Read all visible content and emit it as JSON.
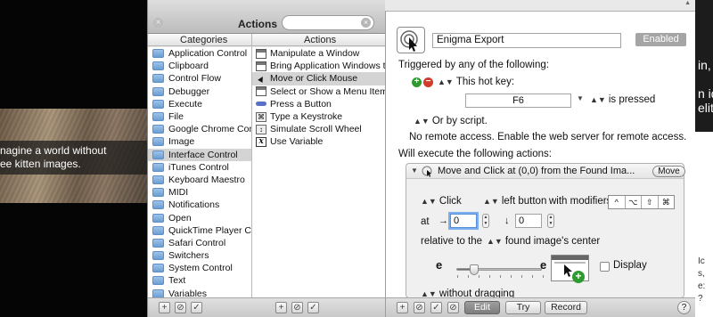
{
  "background": {
    "caption_lines": [
      "nagine a world without",
      "ee kitten images."
    ],
    "right_fragments": [
      "in,",
      "n id",
      "elit."
    ],
    "right_small": [
      "Ic",
      "s,",
      "e:",
      "?"
    ]
  },
  "window": {
    "title": "Actions",
    "close_glyph": "×",
    "clear_glyph": "×"
  },
  "columns": {
    "categories_header": "Categories",
    "actions_header": "Actions"
  },
  "categories": [
    "Application Control",
    "Clipboard",
    "Control Flow",
    "Debugger",
    "Execute",
    "File",
    "Google Chrome Control",
    "Image",
    "Interface Control",
    "iTunes Control",
    "Keyboard Maestro",
    "MIDI",
    "Notifications",
    "Open",
    "QuickTime Player Co...",
    "Safari Control",
    "Switchers",
    "System Control",
    "Text",
    "Variables"
  ],
  "selected_category": "Interface Control",
  "actions": [
    {
      "label": "Manipulate a Window",
      "icon": "window-icon"
    },
    {
      "label": "Bring Application Windows t...",
      "icon": "window-icon"
    },
    {
      "label": "Move or Click Mouse",
      "icon": "mouse-pointer-icon"
    },
    {
      "label": "Select or Show a Menu Item",
      "icon": "menu-icon"
    },
    {
      "label": "Press a Button",
      "icon": "button-icon"
    },
    {
      "label": "Type a Keystroke",
      "icon": "keystroke-icon"
    },
    {
      "label": "Simulate Scroll Wheel",
      "icon": "scroll-wheel-icon"
    },
    {
      "label": "Use Variable",
      "icon": "variable-icon"
    }
  ],
  "selected_action": "Move or Click Mouse",
  "left_footer": {
    "add": "+",
    "options": "⊘",
    "check": "✓"
  },
  "macro": {
    "name": "Enigma Export",
    "enabled_label": "Enabled",
    "triggered_label": "Triggered by any of the following:",
    "hotkey_label": "This hot key:",
    "hotkey_value": "F6",
    "is_pressed": "is pressed",
    "or_by_script": "Or by script.",
    "remote_text": "No remote access.  Enable the web server for remote access.",
    "will_execute": "Will execute the following actions:"
  },
  "action": {
    "title": "Move and Click at (0,0) from the Found Ima...",
    "move_label": "Move",
    "click_type": "Click",
    "button": "left button",
    "with_modifiers": "with modifiers",
    "modifier_keys": [
      "^",
      "⌥",
      "⇧",
      "⌘"
    ],
    "at_label": "at",
    "x_arrow": "→",
    "x_value": "0",
    "y_arrow": "↓",
    "y_value": "0",
    "relative_label": "relative to the",
    "relative_target": "found image's center",
    "fuzz_left": "e",
    "fuzz_right": "e",
    "fuzz_level": 0.2,
    "display_label": "Display",
    "drag_option": "without dragging"
  },
  "right_footer": {
    "add": "+",
    "options": "⊘",
    "check": "✓",
    "edit": "Edit",
    "try": "Try",
    "record": "Record",
    "help": "?"
  },
  "colors": {
    "selection": "#d4d4d4",
    "add_green": "#2f9a2f",
    "remove_red": "#d23a2a",
    "focus_blue": "#7aaef0"
  }
}
